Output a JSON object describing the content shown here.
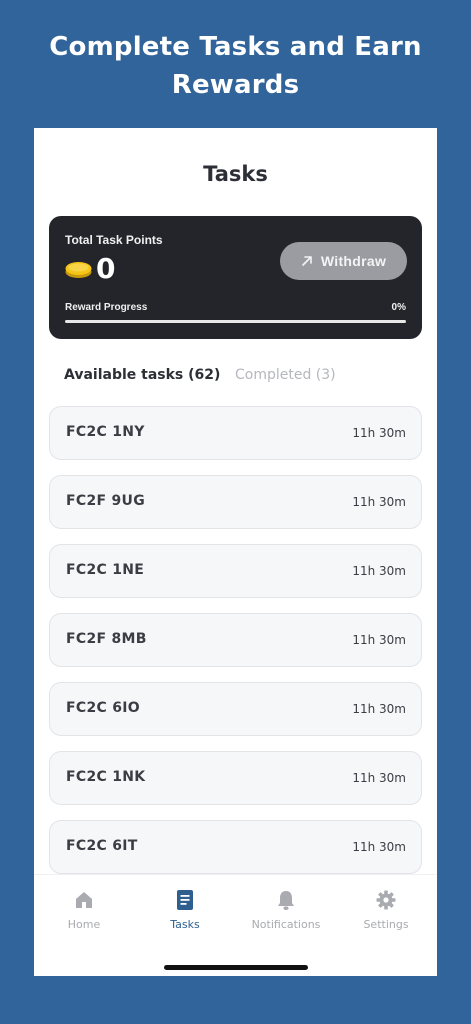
{
  "promo": {
    "title": "Complete Tasks and Earn Rewards"
  },
  "header": {
    "title": "Tasks"
  },
  "points_card": {
    "label": "Total Task Points",
    "value": "0",
    "withdraw_label": "Withdraw",
    "progress_label": "Reward Progress",
    "progress_percent_text": "0%",
    "progress_fraction": 0
  },
  "tabs": {
    "available": "Available tasks (62)",
    "completed": "Completed (3)"
  },
  "tasks": [
    {
      "name": "FC2C 1NY",
      "time": "11h 30m"
    },
    {
      "name": "FC2F 9UG",
      "time": "11h 30m"
    },
    {
      "name": "FC2C 1NE",
      "time": "11h 30m"
    },
    {
      "name": "FC2F 8MB",
      "time": "11h 30m"
    },
    {
      "name": "FC2C 6IO",
      "time": "11h 30m"
    },
    {
      "name": "FC2C 1NK",
      "time": "11h 30m"
    },
    {
      "name": "FC2C 6IT",
      "time": "11h 30m"
    }
  ],
  "tabbar": {
    "items": [
      {
        "label": "Home",
        "icon": "home-icon"
      },
      {
        "label": "Tasks",
        "icon": "document-icon"
      },
      {
        "label": "Notifications",
        "icon": "bell-icon"
      },
      {
        "label": "Settings",
        "icon": "gear-icon"
      }
    ],
    "active": "Tasks"
  },
  "colors": {
    "background": "#31649a",
    "card_dark": "#23252a",
    "accent": "#2e5f8f",
    "coin": "#f5c518"
  }
}
